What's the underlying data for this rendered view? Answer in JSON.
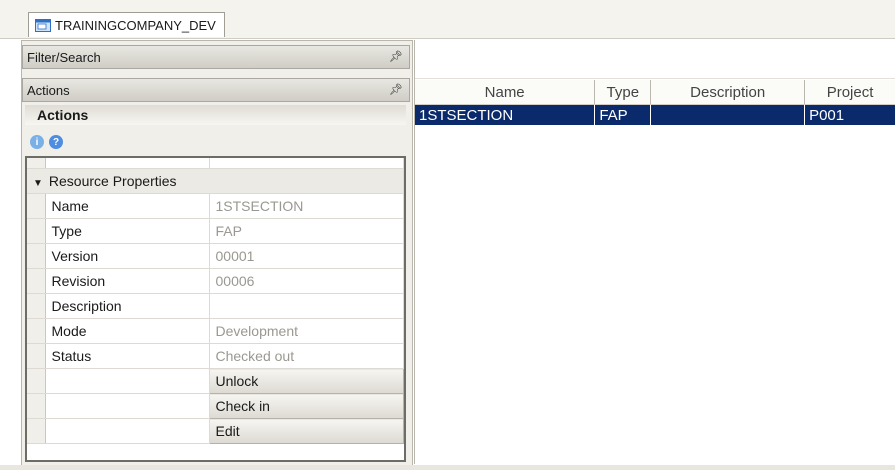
{
  "tab": {
    "title": "TRAININGCOMPANY_DEV",
    "icon": "window-icon"
  },
  "left": {
    "filter_header": "Filter/Search",
    "actions_header": "Actions",
    "actions_title": "Actions",
    "icons": [
      "info-icon",
      "help-icon"
    ],
    "section_label": "Resource Properties",
    "properties": [
      {
        "label": "Name",
        "value": "1STSECTION"
      },
      {
        "label": "Type",
        "value": "FAP"
      },
      {
        "label": "Version",
        "value": "00001"
      },
      {
        "label": "Revision",
        "value": "00006"
      },
      {
        "label": "Description",
        "value": ""
      },
      {
        "label": "Mode",
        "value": "Development"
      },
      {
        "label": "Status",
        "value": "Checked out"
      }
    ],
    "buttons": {
      "unlock": "Unlock",
      "checkin": "Check in",
      "edit": "Edit"
    }
  },
  "right": {
    "columns": [
      "Name",
      "Type",
      "Description",
      "Project"
    ],
    "rows": [
      {
        "name": "1STSECTION",
        "type": "FAP",
        "description": "",
        "project": "P001"
      }
    ]
  },
  "colors": {
    "selection": "#0b2a6b",
    "panel": "#f0efe9"
  }
}
